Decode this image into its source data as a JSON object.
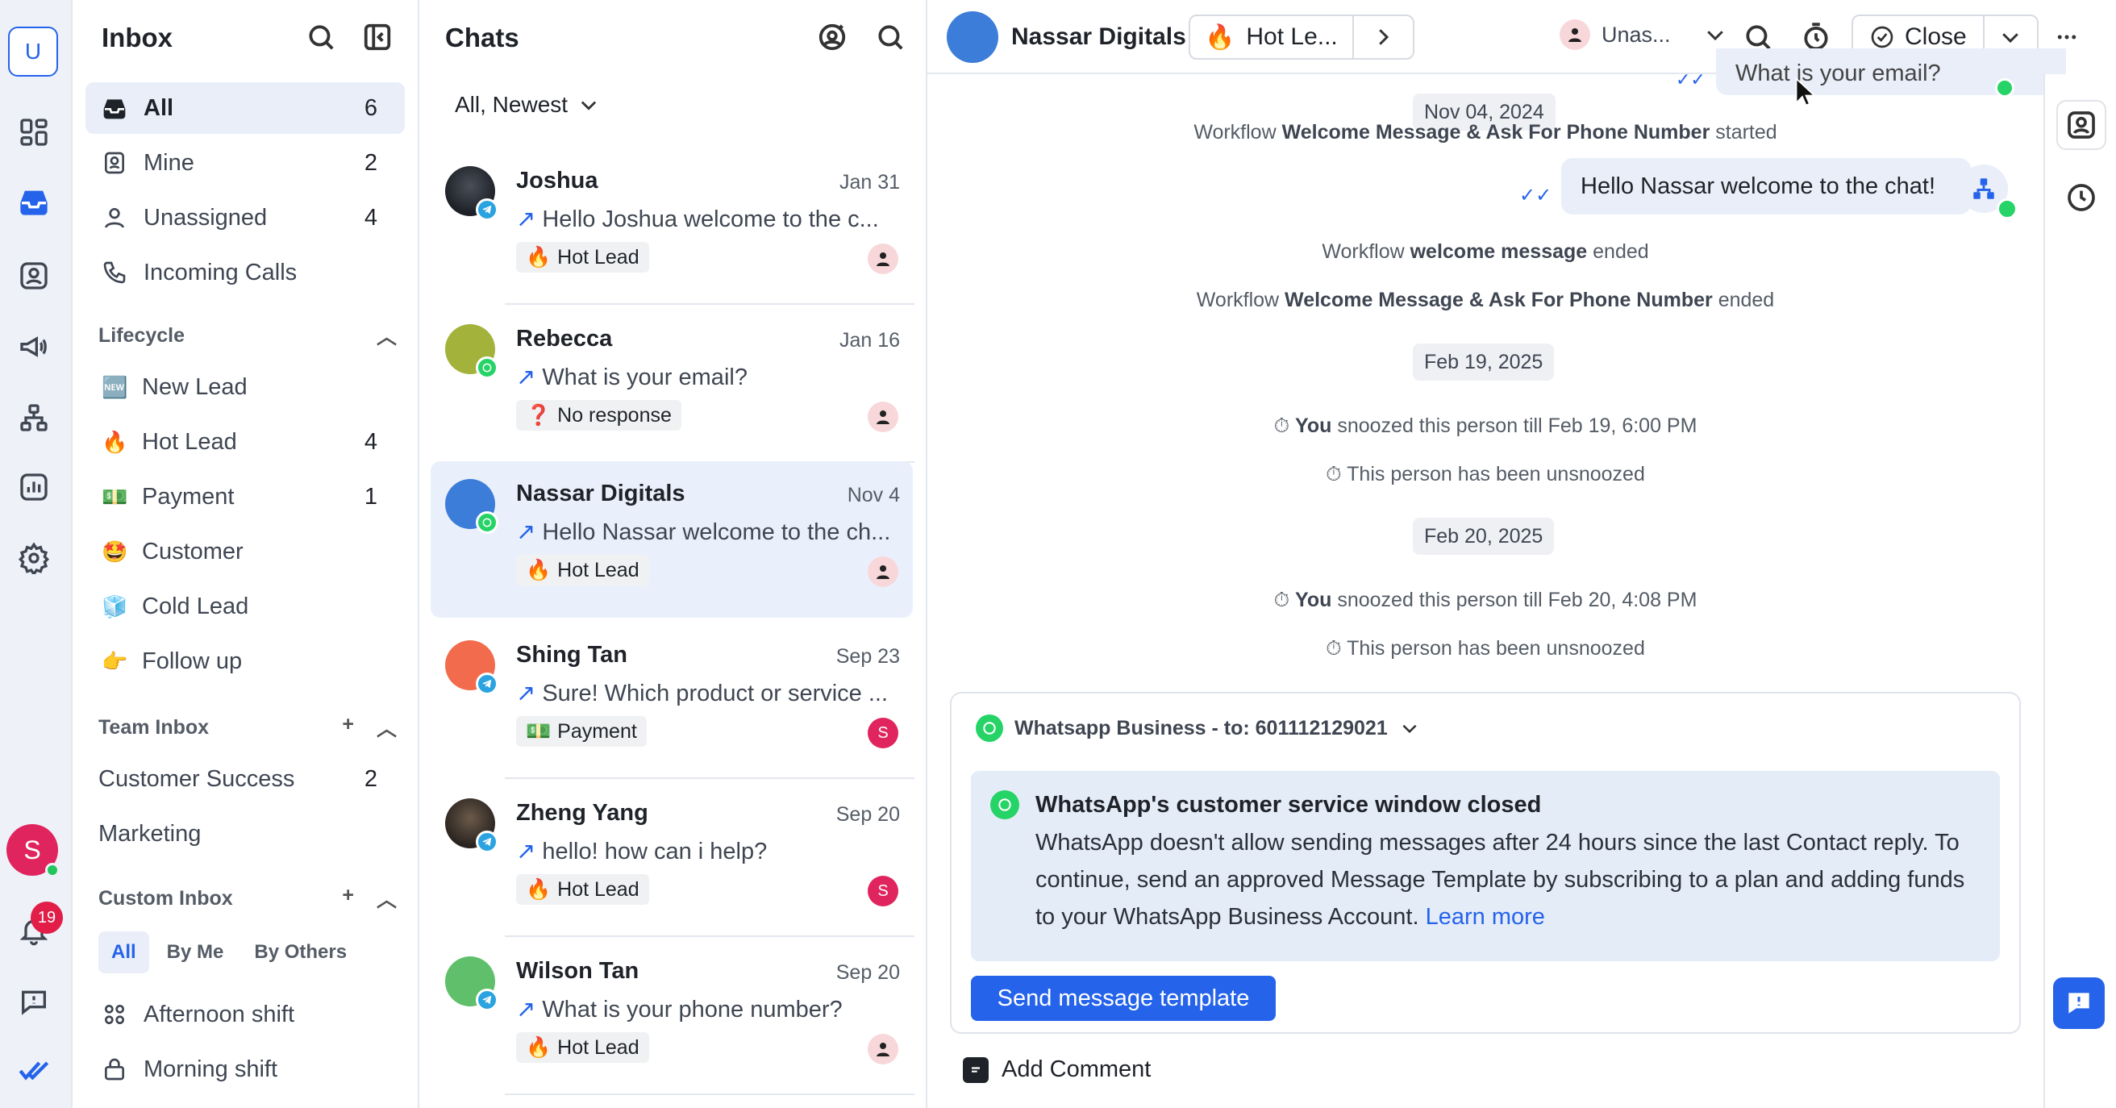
{
  "rail": {
    "workspace_initial": "U",
    "user_initial": "S",
    "notifications_count": "19"
  },
  "inbox": {
    "title": "Inbox",
    "nav": [
      {
        "label": "All",
        "count": "6"
      },
      {
        "label": "Mine",
        "count": "2"
      },
      {
        "label": "Unassigned",
        "count": "4"
      },
      {
        "label": "Incoming Calls",
        "count": ""
      }
    ],
    "lifecycle_title": "Lifecycle",
    "lifecycle": [
      {
        "emoji": "🆕",
        "label": "New Lead",
        "count": ""
      },
      {
        "emoji": "🔥",
        "label": "Hot Lead",
        "count": "4"
      },
      {
        "emoji": "💵",
        "label": "Payment",
        "count": "1"
      },
      {
        "emoji": "🤩",
        "label": "Customer",
        "count": ""
      },
      {
        "emoji": "🧊",
        "label": "Cold Lead",
        "count": ""
      },
      {
        "emoji": "👉",
        "label": "Follow up",
        "count": ""
      }
    ],
    "team_title": "Team Inbox",
    "team": [
      {
        "label": "Customer Success",
        "count": "2"
      },
      {
        "label": "Marketing",
        "count": ""
      }
    ],
    "custom_title": "Custom Inbox",
    "custom_tabs": [
      "All",
      "By Me",
      "By Others"
    ],
    "custom": [
      {
        "label": "Afternoon shift"
      },
      {
        "label": "Morning shift"
      }
    ]
  },
  "chats": {
    "title": "Chats",
    "filter": "All, Newest",
    "items": [
      {
        "name": "Joshua",
        "date": "Jan 31",
        "preview": "Hello Joshua welcome to the c...",
        "tag_emoji": "🔥",
        "tag": "Hot Lead",
        "assignee": "",
        "channel": "telegram"
      },
      {
        "name": "Rebecca",
        "date": "Jan 16",
        "preview": "What is your email?",
        "tag_emoji": "❓",
        "tag": "No response",
        "assignee": "",
        "channel": "whatsapp"
      },
      {
        "name": "Nassar Digitals",
        "date": "Nov 4",
        "preview": "Hello Nassar welcome to the ch...",
        "tag_emoji": "🔥",
        "tag": "Hot Lead",
        "assignee": "",
        "channel": "whatsapp"
      },
      {
        "name": "Shing Tan",
        "date": "Sep 23",
        "preview": "Sure! Which product or service ...",
        "tag_emoji": "💵",
        "tag": "Payment",
        "assignee": "S",
        "channel": "telegram"
      },
      {
        "name": "Zheng Yang",
        "date": "Sep 20",
        "preview": "hello! how can i help?",
        "tag_emoji": "🔥",
        "tag": "Hot Lead",
        "assignee": "S",
        "channel": "telegram"
      },
      {
        "name": "Wilson Tan",
        "date": "Sep 20",
        "preview": "What is your phone number?",
        "tag_emoji": "🔥",
        "tag": "Hot Lead",
        "assignee": "",
        "channel": "telegram"
      }
    ]
  },
  "conversation": {
    "contact_name": "Nassar Digitals",
    "lifecycle_emoji": "🔥",
    "lifecycle": "Hot Le...",
    "assignee": "Unas...",
    "close_label": "Close",
    "top_bubble": "What is your email?",
    "date1": "Nov 04, 2024",
    "wf_started_pre": "Workflow ",
    "wf_started_name": "Welcome Message & Ask For Phone Number",
    "wf_started_post": " started",
    "bubble_msg": "Hello Nassar welcome to the chat!",
    "wf_ended1_pre": "Workflow ",
    "wf_ended1_name": "welcome message",
    "wf_ended1_post": " ended",
    "wf_ended2_pre": "Workflow ",
    "wf_ended2_name": "Welcome Message & Ask For Phone Number",
    "wf_ended2_post": " ended",
    "date2": "Feb 19, 2025",
    "snooze1_who": "You",
    "snooze1_text": " snoozed this person till Feb 19, 6:00 PM",
    "unsnooze1": "This person has been unsnoozed",
    "date3": "Feb 20, 2025",
    "snooze2_who": "You",
    "snooze2_text": " snoozed this person till Feb 20, 4:08 PM",
    "unsnooze2": "This person has been unsnoozed",
    "channel_label": "Whatsapp Business - to: 601112129021",
    "wa_title": "WhatsApp's customer service window closed",
    "wa_body": "WhatsApp doesn't allow sending messages after 24 hours since the last Contact reply. To continue, send an approved Message Template by subscribing to a plan and adding funds to your WhatsApp Business Account. ",
    "wa_learn_more": "Learn more",
    "send_template": "Send message template",
    "add_comment": "Add Comment"
  },
  "colors": {
    "accent": "#2563eb",
    "selected_bg": "#eaf0fb",
    "whatsapp": "#25d366",
    "telegram": "#2aa3e0",
    "assignee_red": "#e0245e"
  }
}
